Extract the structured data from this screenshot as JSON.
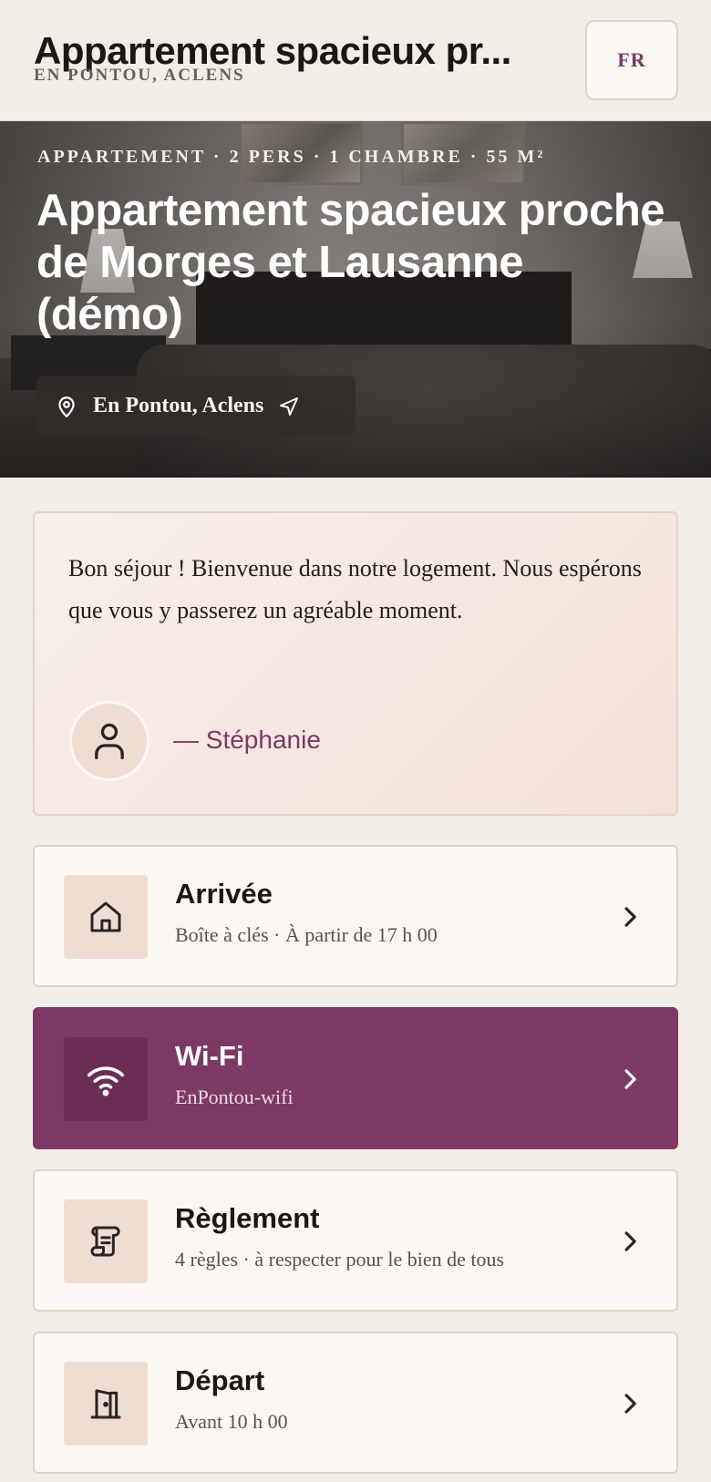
{
  "header": {
    "title": "Appartement spacieux pr...",
    "subtitle": "EN PONTOU, ACLENS",
    "language": "FR"
  },
  "hero": {
    "meta": "APPARTEMENT · 2 PERS · 1 CHAMBRE · 55 M²",
    "title": "Appartement spacieux proche de Morges et Lausanne (démo)",
    "location": "En Pontou, Aclens"
  },
  "welcome": {
    "message": "Bon séjour ! Bienvenue dans notre logement. Nous espérons que vous y passerez un agréable moment.",
    "signature": "— Stéphanie"
  },
  "menu": [
    {
      "title": "Arrivée",
      "subtitle": "Boîte à clés · À partir de 17 h 00",
      "icon": "home-icon"
    },
    {
      "title": "Wi-Fi",
      "subtitle": "EnPontou-wifi",
      "icon": "wifi-icon"
    },
    {
      "title": "Règlement",
      "subtitle": "4 règles · à respecter pour le bien de tous",
      "icon": "scroll-icon"
    },
    {
      "title": "Départ",
      "subtitle": "Avant 10 h 00",
      "icon": "door-icon"
    }
  ],
  "colors": {
    "accent": "#7d3865",
    "background": "#f2ede6",
    "icon_tile": "#f0ddd2"
  }
}
